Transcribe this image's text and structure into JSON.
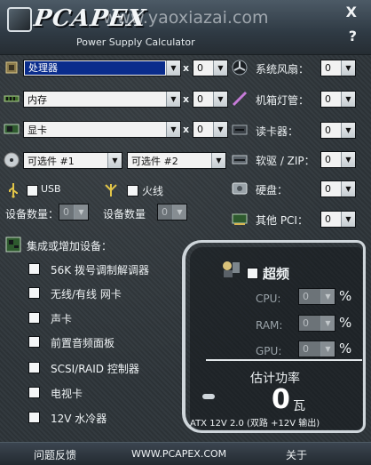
{
  "header": {
    "logo_text": "PCAPEX",
    "subtitle": "Power Supply Calculator",
    "watermark": "www.yaoxiazai.com",
    "close_label": "X",
    "help_label": "?"
  },
  "left_rows": {
    "cpu": {
      "value": "处理器",
      "times": "x",
      "count": "0"
    },
    "memory": {
      "value": "内存",
      "times": "x",
      "count": "0"
    },
    "gpu": {
      "value": "显卡",
      "times": "x",
      "count": "0"
    },
    "optional": {
      "value1": "可选件 #1",
      "value2": "可选件 #2"
    }
  },
  "right_rows": [
    {
      "label": "系统风扇：",
      "count": "0"
    },
    {
      "label": "机箱灯管：",
      "count": "0"
    },
    {
      "label": "读卡器：",
      "count": "0"
    },
    {
      "label": "软驱 / ZIP：",
      "count": "0"
    },
    {
      "label": "硬盘：",
      "count": "0"
    },
    {
      "label": "其他 PCI：",
      "count": "0"
    }
  ],
  "usb": {
    "label": "USB",
    "qty_label": "设备数量：",
    "qty": "0"
  },
  "firewire": {
    "label": "火线",
    "qty_label": "设备数量",
    "qty": "0"
  },
  "integrated": {
    "title": "集成或增加设备：",
    "items": [
      "56K 拨号调制解调器",
      "无线/有线 网卡",
      "声卡",
      "前置音频面板",
      "SCSI/RAID 控制器",
      "电视卡",
      "12V 水冷器"
    ]
  },
  "overclock": {
    "label": "超频",
    "rows": [
      {
        "label": "CPU:",
        "value": "0",
        "unit": "%"
      },
      {
        "label": "RAM:",
        "value": "0",
        "unit": "%"
      },
      {
        "label": "GPU:",
        "value": "0",
        "unit": "%"
      }
    ]
  },
  "power": {
    "title": "估计功率",
    "value": "0",
    "unit": "瓦",
    "standard": "ATX 12V 2.0 (双路 +12V 输出)"
  },
  "footer": {
    "feedback": "问题反馈",
    "website": "WWW.PCAPEX.COM",
    "about": "关于"
  }
}
